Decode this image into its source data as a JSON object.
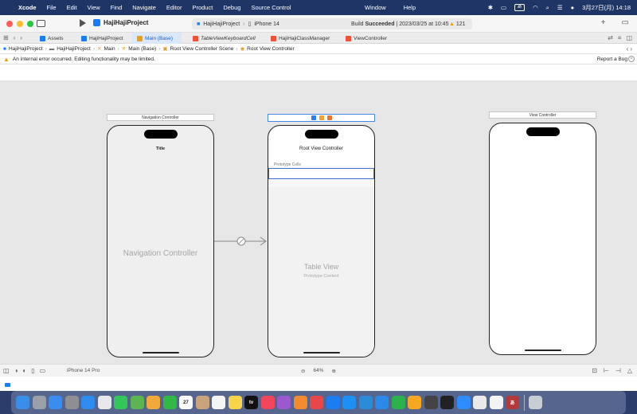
{
  "menubar": {
    "app": "Xcode",
    "menus": [
      "File",
      "Edit",
      "View",
      "Find",
      "Navigate",
      "Editor",
      "Product",
      "Debug",
      "Source Control"
    ],
    "right_menus": [
      "Window",
      "Help"
    ],
    "input_indicator": "あ",
    "clock": "3月27日(月)  14:18"
  },
  "toolbar": {
    "project_name": "HajiHajiProject",
    "scheme_project": "HajiHajiProject",
    "scheme_device": "iPhone 14",
    "build_status_prefix": "Build ",
    "build_status_bold": "Succeeded",
    "build_status_suffix": " | 2023/03/25 at 10:45",
    "warning_count": "121",
    "add_label": "+"
  },
  "tabs": [
    {
      "label": "Assets",
      "color": "#1a7cf5"
    },
    {
      "label": "HajiHajiProject",
      "color": "#1a7cf5"
    },
    {
      "label": "Main (Base)",
      "color": "#e0a030",
      "active": true
    },
    {
      "label": "TableViewKeyboardCell",
      "color": "#f05138",
      "italic": true
    },
    {
      "label": "HajiHajiClassManager",
      "color": "#f05138"
    },
    {
      "label": "ViewController",
      "color": "#f05138"
    }
  ],
  "breadcrumb": [
    "HajiHajiProject",
    "HajiHajiProject",
    "Main",
    "Main (Base)",
    "Root View Controller Scene",
    "Root View Controller"
  ],
  "error": {
    "message": "An internal error occurred. Editing functionality may be limited.",
    "report": "Report a Bug"
  },
  "canvas": {
    "nav_scene_title": "Navigation Controller",
    "nav_bar_title": "Title",
    "nav_body_label": "Navigation Controller",
    "root_title": "Root View Controller",
    "prototype_cells": "Prototype Cells",
    "table_view": "Table View",
    "prototype_content": "Prototype Content",
    "vc_scene_title": "View Controller"
  },
  "bottom": {
    "device": "iPhone 14 Pro",
    "zoom": "64%"
  },
  "dock": [
    {
      "name": "finder",
      "color": "#3b8ee8"
    },
    {
      "name": "launchpad",
      "color": "#9aa0a8"
    },
    {
      "name": "mail",
      "color": "#3a8df0"
    },
    {
      "name": "settings",
      "color": "#8e8e93"
    },
    {
      "name": "safari",
      "color": "#2e8cf0"
    },
    {
      "name": "chrome",
      "color": "#e8e8e8"
    },
    {
      "name": "messages",
      "color": "#33c759"
    },
    {
      "name": "maps",
      "color": "#5ab552"
    },
    {
      "name": "photos",
      "color": "#f2a93b"
    },
    {
      "name": "facetime",
      "color": "#31b947"
    },
    {
      "name": "calendar",
      "color": "#ffffff",
      "label": "27"
    },
    {
      "name": "contacts",
      "color": "#c9a37b"
    },
    {
      "name": "reminders",
      "color": "#f4f4f4"
    },
    {
      "name": "notes",
      "color": "#f7d44a"
    },
    {
      "name": "tv",
      "color": "#111111",
      "label": "tv"
    },
    {
      "name": "music",
      "color": "#f0455a"
    },
    {
      "name": "podcasts",
      "color": "#9b59d0"
    },
    {
      "name": "books",
      "color": "#f28a2f"
    },
    {
      "name": "numbers-news",
      "color": "#e8474a"
    },
    {
      "name": "xcode-tools",
      "color": "#1c7cf2"
    },
    {
      "name": "app-store",
      "color": "#1d8ff5"
    },
    {
      "name": "vscode",
      "color": "#2c8bd8"
    },
    {
      "name": "keynote",
      "color": "#2b89ea"
    },
    {
      "name": "numbers",
      "color": "#2bb24c"
    },
    {
      "name": "pages",
      "color": "#f6a623"
    },
    {
      "name": "github",
      "color": "#444444"
    },
    {
      "name": "terminal",
      "color": "#222222"
    },
    {
      "name": "zoom",
      "color": "#2d8cff"
    },
    {
      "name": "instruments",
      "color": "#e9e9e9"
    },
    {
      "name": "textedit",
      "color": "#f3f3f3"
    },
    {
      "name": "kana-app",
      "color": "#b33a3a",
      "label": "あ"
    },
    {
      "name": "trash",
      "color": "#c8ccd4"
    }
  ]
}
